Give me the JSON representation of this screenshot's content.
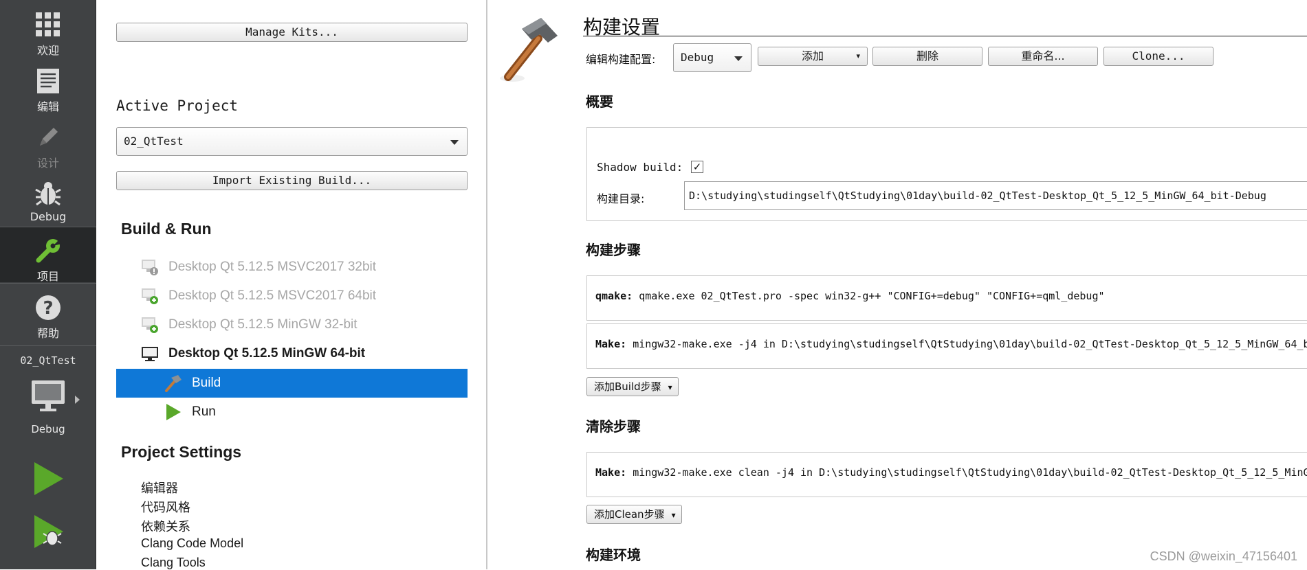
{
  "modes": [
    {
      "id": "welcome",
      "label": "欢迎",
      "icon": "grid-icon",
      "state": "normal"
    },
    {
      "id": "edit",
      "label": "编辑",
      "icon": "document-icon",
      "state": "normal"
    },
    {
      "id": "design",
      "label": "设计",
      "icon": "pencil-icon",
      "state": "disabled"
    },
    {
      "id": "debug",
      "label": "Debug",
      "icon": "bug-icon",
      "state": "normal"
    },
    {
      "id": "projects",
      "label": "项目",
      "icon": "wrench-icon",
      "state": "active"
    },
    {
      "id": "help",
      "label": "帮助",
      "icon": "help-icon",
      "state": "normal"
    }
  ],
  "kit_selector": {
    "project": "02_QtTest",
    "config": "Debug"
  },
  "tree": {
    "manage_kits": "Manage Kits...",
    "active_project_label": "Active Project",
    "active_project": "02_QtTest",
    "import_build": "Import Existing Build...",
    "build_run_title": "Build & Run",
    "kits": [
      {
        "name": "Desktop Qt 5.12.5 MSVC2017 32bit",
        "status": "warning",
        "enabled": false
      },
      {
        "name": "Desktop Qt 5.12.5 MSVC2017 64bit",
        "status": "add",
        "enabled": false
      },
      {
        "name": "Desktop Qt 5.12.5 MinGW 32-bit",
        "status": "add",
        "enabled": false
      },
      {
        "name": "Desktop Qt 5.12.5 MinGW 64-bit",
        "status": "active",
        "enabled": true
      }
    ],
    "sub_items": [
      {
        "label": "Build",
        "selected": true
      },
      {
        "label": "Run",
        "selected": false
      }
    ],
    "project_settings_title": "Project Settings",
    "project_settings": [
      "编辑器",
      "代码风格",
      "依赖关系",
      "Clang Code Model",
      "Clang Tools"
    ]
  },
  "settings": {
    "title": "构建设置",
    "edit_config_label": "编辑构建配置:",
    "config_value": "Debug",
    "buttons": {
      "add": "添加",
      "delete": "删除",
      "rename": "重命名...",
      "clone": "Clone..."
    },
    "overview": {
      "title": "概要",
      "shadow_build_label": "Shadow build:",
      "shadow_build_checked": true,
      "check_mark": "✓",
      "build_dir_label": "构建目录:",
      "build_dir": "D:\\studying\\studingself\\QtStudying\\01day\\build-02_QtTest-Desktop_Qt_5_12_5_MinGW_64_bit-Debug"
    },
    "build_steps": {
      "title": "构建步骤",
      "steps": [
        {
          "label": "qmake:",
          "command": "qmake.exe 02_QtTest.pro -spec win32-g++ \"CONFIG+=debug\" \"CONFIG+=qml_debug\""
        },
        {
          "label": "Make:",
          "command": "mingw32-make.exe -j4 in D:\\studying\\studingself\\QtStudying\\01day\\build-02_QtTest-Desktop_Qt_5_12_5_MinGW_64_b"
        }
      ],
      "add_button": "添加Build步骤"
    },
    "clean_steps": {
      "title": "清除步骤",
      "steps": [
        {
          "label": "Make:",
          "command": "mingw32-make.exe clean -j4 in D:\\studying\\studingself\\QtStudying\\01day\\build-02_QtTest-Desktop_Qt_5_12_5_MinG"
        }
      ],
      "add_button": "添加Clean步骤"
    },
    "build_env_title": "构建环境"
  },
  "watermark": "CSDN @weixin_47156401",
  "colors": {
    "selection": "#0f78d7",
    "modebar": "#404244",
    "active_mode": "#262829",
    "green": "#5aa82a"
  }
}
